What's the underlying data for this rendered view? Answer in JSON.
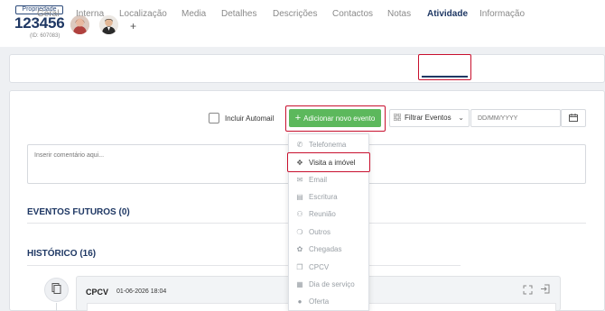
{
  "property": {
    "badge_label": "Propriedade",
    "number": "123456",
    "id_text": "(ID: 607083)",
    "add_agent": "+"
  },
  "tabs": [
    {
      "label": "Geral"
    },
    {
      "label": "Interna"
    },
    {
      "label": "Localização"
    },
    {
      "label": "Media"
    },
    {
      "label": "Detalhes"
    },
    {
      "label": "Descrições"
    },
    {
      "label": "Contactos"
    },
    {
      "label": "Notas"
    },
    {
      "label": "Atividade",
      "active": true
    },
    {
      "label": "Informação"
    }
  ],
  "toolbar": {
    "automail_label": "Incluir Automail",
    "add_event_label": "Adicionar novo evento",
    "add_event_plus": "+",
    "filter_label": "Filtrar Eventos",
    "date_placeholder": "DD/MM/YYYY"
  },
  "comment": {
    "placeholder": "Inserir comentário aqui..."
  },
  "sections": {
    "future_title": "EVENTOS FUTUROS (0)",
    "history_title": "HISTÓRICO (16)"
  },
  "event": {
    "name": "CPCV",
    "date": "01-06-2026 18:04"
  },
  "dropdown": {
    "items": [
      {
        "label": "Telefonema",
        "icon": "phone-icon"
      },
      {
        "label": "Visita a imóvel",
        "icon": "map-pin-icon",
        "highlighted": true
      },
      {
        "label": "Email",
        "icon": "email-icon"
      },
      {
        "label": "Escritura",
        "icon": "document-icon"
      },
      {
        "label": "Reunião",
        "icon": "people-icon"
      },
      {
        "label": "Outros",
        "icon": "paperclip-icon"
      },
      {
        "label": "Chegadas",
        "icon": "handshake-icon"
      },
      {
        "label": "CPCV",
        "icon": "contract-icon"
      },
      {
        "label": "Dia de serviço",
        "icon": "calendar-icon"
      },
      {
        "label": "Oferta",
        "icon": "offer-icon"
      }
    ]
  },
  "colors": {
    "brand": "#1f3864",
    "accent_green": "#5cb85c",
    "highlight_red": "#c8102e"
  }
}
